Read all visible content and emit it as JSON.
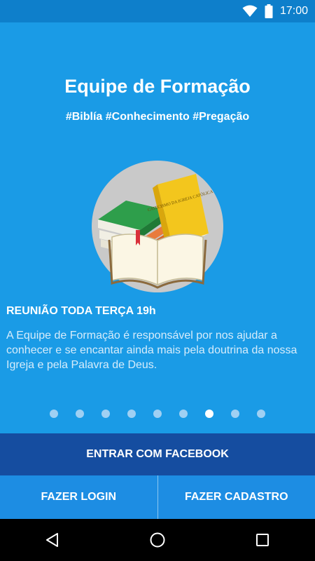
{
  "status_bar": {
    "time": "17:00",
    "icons": [
      "wifi-icon",
      "battery-icon"
    ]
  },
  "slide": {
    "title": "Equipe de Formação",
    "tags": "#Biblía #Conhecimento #Pregação",
    "book_cover_text": "CATECISMO DA IGREJA CATÓLICA",
    "heading": "REUNIÃO TODA TERÇA 19h",
    "description": "A Equipe de Formação é responsável por nos ajudar a conhecer e se encantar ainda mais pela doutrina da nossa Igreja e pela Palavra de Deus."
  },
  "pager": {
    "total": 9,
    "active_index": 6
  },
  "actions": {
    "facebook_label": "ENTRAR COM FACEBOOK",
    "login_label": "FAZER LOGIN",
    "signup_label": "FAZER CADASTRO"
  },
  "nav": {
    "icons": [
      "back-icon",
      "home-icon",
      "recents-icon"
    ]
  },
  "colors": {
    "background": "#1a9be6",
    "status_bar": "#0e7fcb",
    "facebook_button": "#154da0",
    "secondary_buttons": "#1d8de3"
  }
}
